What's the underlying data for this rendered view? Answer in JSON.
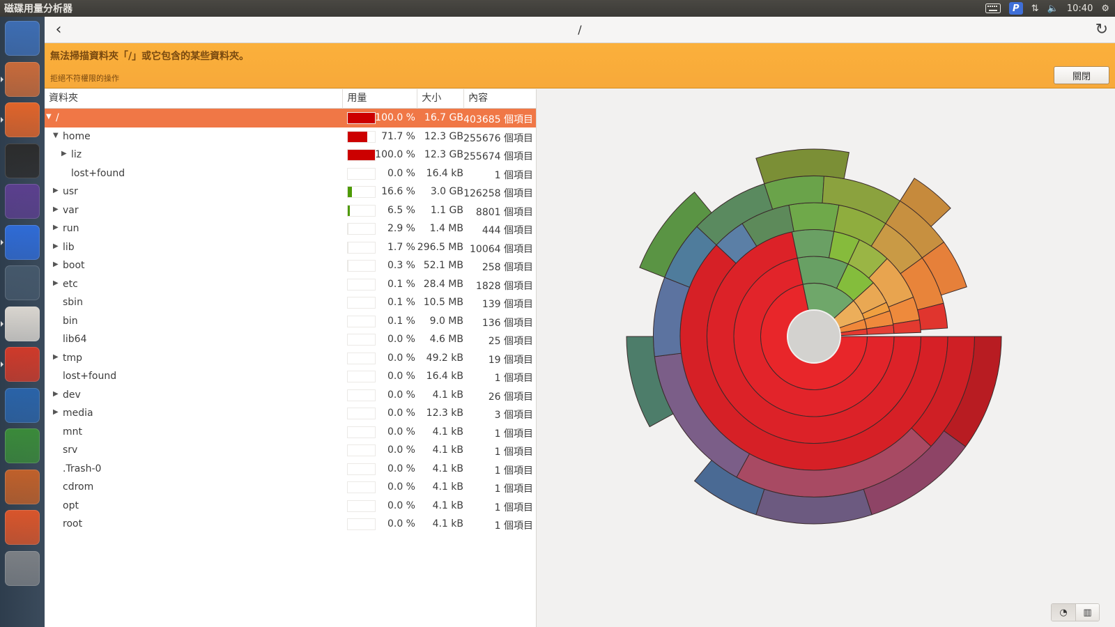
{
  "window": {
    "title": "磁碟用量分析器"
  },
  "tray": {
    "time": "10:40",
    "keyboard_icon": "keyboard-icon",
    "p_icon": "p-indicator-icon"
  },
  "header": {
    "path": "/"
  },
  "infobar": {
    "primary": "無法掃描資料夾「/」或它包含的某些資料夾。",
    "secondary": "拒絕不符權限的操作",
    "close_label": "關閉"
  },
  "tree": {
    "columns": {
      "folder": "資料夾",
      "usage": "用量",
      "size": "大小",
      "contents": "內容"
    },
    "rows": [
      {
        "name": "/",
        "level": 0,
        "expander": "open",
        "pct": "100.0 %",
        "size": "16.7 GB",
        "items": "403685 個項目",
        "usage": 1.0,
        "bar_color": "#cc0000",
        "selected": true
      },
      {
        "name": "home",
        "level": 1,
        "expander": "open",
        "pct": "71.7 %",
        "size": "12.3 GB",
        "items": "255676 個項目",
        "usage": 0.717,
        "bar_color": "#cc0000"
      },
      {
        "name": "liz",
        "level": 2,
        "expander": "closed",
        "pct": "100.0 %",
        "size": "12.3 GB",
        "items": "255674 個項目",
        "usage": 1.0,
        "bar_color": "#cc0000"
      },
      {
        "name": "lost+found",
        "level": 2,
        "expander": "none",
        "pct": "0.0 %",
        "size": "16.4 kB",
        "items": "1 個項目",
        "usage": 0.0,
        "bar_color": "#cc0000"
      },
      {
        "name": "usr",
        "level": 1,
        "expander": "closed",
        "pct": "16.6 %",
        "size": "3.0 GB",
        "items": "126258 個項目",
        "usage": 0.166,
        "bar_color": "#4e9a06"
      },
      {
        "name": "var",
        "level": 1,
        "expander": "closed",
        "pct": "6.5 %",
        "size": "1.1 GB",
        "items": "8801 個項目",
        "usage": 0.065,
        "bar_color": "#4e9a06"
      },
      {
        "name": "run",
        "level": 1,
        "expander": "closed",
        "pct": "2.9 %",
        "size": "1.4 MB",
        "items": "444 個項目",
        "usage": 0.029,
        "bar_color": "#e8e6e3"
      },
      {
        "name": "lib",
        "level": 1,
        "expander": "closed",
        "pct": "1.7 %",
        "size": "296.5 MB",
        "items": "10064 個項目",
        "usage": 0.017,
        "bar_color": "#e8e6e3"
      },
      {
        "name": "boot",
        "level": 1,
        "expander": "closed",
        "pct": "0.3 %",
        "size": "52.1 MB",
        "items": "258 個項目",
        "usage": 0.003,
        "bar_color": "#e8e6e3"
      },
      {
        "name": "etc",
        "level": 1,
        "expander": "closed",
        "pct": "0.1 %",
        "size": "28.4 MB",
        "items": "1828 個項目",
        "usage": 0.001,
        "bar_color": "#e8e6e3"
      },
      {
        "name": "sbin",
        "level": 1,
        "expander": "none",
        "pct": "0.1 %",
        "size": "10.5 MB",
        "items": "139 個項目",
        "usage": 0.001,
        "bar_color": "#e8e6e3"
      },
      {
        "name": "bin",
        "level": 1,
        "expander": "none",
        "pct": "0.1 %",
        "size": "9.0 MB",
        "items": "136 個項目",
        "usage": 0.001,
        "bar_color": "#e8e6e3"
      },
      {
        "name": "lib64",
        "level": 1,
        "expander": "none",
        "pct": "0.0 %",
        "size": "4.6 MB",
        "items": "25 個項目",
        "usage": 0.0,
        "bar_color": "#e8e6e3"
      },
      {
        "name": "tmp",
        "level": 1,
        "expander": "closed",
        "pct": "0.0 %",
        "size": "49.2 kB",
        "items": "19 個項目",
        "usage": 0.0,
        "bar_color": "#e8e6e3"
      },
      {
        "name": "lost+found",
        "level": 1,
        "expander": "none",
        "pct": "0.0 %",
        "size": "16.4 kB",
        "items": "1 個項目",
        "usage": 0.0,
        "bar_color": "#e8e6e3"
      },
      {
        "name": "dev",
        "level": 1,
        "expander": "closed",
        "pct": "0.0 %",
        "size": "4.1 kB",
        "items": "26 個項目",
        "usage": 0.0,
        "bar_color": "#e8e6e3"
      },
      {
        "name": "media",
        "level": 1,
        "expander": "closed",
        "pct": "0.0 %",
        "size": "12.3 kB",
        "items": "3 個項目",
        "usage": 0.0,
        "bar_color": "#e8e6e3"
      },
      {
        "name": "mnt",
        "level": 1,
        "expander": "none",
        "pct": "0.0 %",
        "size": "4.1 kB",
        "items": "1 個項目",
        "usage": 0.0,
        "bar_color": "#e8e6e3"
      },
      {
        "name": "srv",
        "level": 1,
        "expander": "none",
        "pct": "0.0 %",
        "size": "4.1 kB",
        "items": "1 個項目",
        "usage": 0.0,
        "bar_color": "#e8e6e3"
      },
      {
        "name": ".Trash-0",
        "level": 1,
        "expander": "none",
        "pct": "0.0 %",
        "size": "4.1 kB",
        "items": "1 個項目",
        "usage": 0.0,
        "bar_color": "#e8e6e3"
      },
      {
        "name": "cdrom",
        "level": 1,
        "expander": "none",
        "pct": "0.0 %",
        "size": "4.1 kB",
        "items": "1 個項目",
        "usage": 0.0,
        "bar_color": "#e8e6e3"
      },
      {
        "name": "opt",
        "level": 1,
        "expander": "none",
        "pct": "0.0 %",
        "size": "4.1 kB",
        "items": "1 個項目",
        "usage": 0.0,
        "bar_color": "#e8e6e3"
      },
      {
        "name": "root",
        "level": 1,
        "expander": "none",
        "pct": "0.0 %",
        "size": "4.1 kB",
        "items": "1 個項目",
        "usage": 0.0,
        "bar_color": "#e8e6e3"
      }
    ]
  },
  "launcher": [
    {
      "name": "dash-home-icon",
      "color": "#3d6db3"
    },
    {
      "name": "files-icon",
      "color": "#c86a3a",
      "running": true
    },
    {
      "name": "firefox-icon",
      "color": "#e0642a",
      "running": true
    },
    {
      "name": "terminal-icon",
      "color": "#2c2c2c"
    },
    {
      "name": "eclipse-icon",
      "color": "#5b3f8e"
    },
    {
      "name": "p-app-icon",
      "color": "#2f6bd6",
      "running": true
    },
    {
      "name": "workspace-switcher-icon",
      "color": "#45586b"
    },
    {
      "name": "text-editor-icon",
      "color": "#d9d5cf",
      "running": true
    },
    {
      "name": "disk-usage-analyzer-icon",
      "color": "#cf3a2a",
      "running": true
    },
    {
      "name": "writer-icon",
      "color": "#2a63a8"
    },
    {
      "name": "calc-icon",
      "color": "#3a8a3a"
    },
    {
      "name": "impress-icon",
      "color": "#c0602a"
    },
    {
      "name": "amazon-icon",
      "color": "#d9552b"
    },
    {
      "name": "trash-icon",
      "color": "#7b7f84"
    }
  ],
  "sunburst": {
    "rings": [
      {
        "level": 1,
        "segments": [
          {
            "start": 0.0,
            "end": 0.717,
            "color": "#e8262a"
          },
          {
            "start": 0.717,
            "end": 0.883,
            "color": "#6fa76a"
          },
          {
            "start": 0.883,
            "end": 0.948,
            "color": "#ecae5a"
          },
          {
            "start": 0.948,
            "end": 0.977,
            "color": "#f0883a"
          },
          {
            "start": 0.977,
            "end": 0.994,
            "color": "#e43a30"
          }
        ]
      },
      {
        "level": 2,
        "segments": [
          {
            "start": 0.0,
            "end": 0.717,
            "color": "#e2242a"
          },
          {
            "start": 0.717,
            "end": 0.82,
            "color": "#68a064"
          },
          {
            "start": 0.82,
            "end": 0.883,
            "color": "#84bd3c"
          },
          {
            "start": 0.883,
            "end": 0.93,
            "color": "#e9a853"
          },
          {
            "start": 0.93,
            "end": 0.948,
            "color": "#f0a040"
          },
          {
            "start": 0.948,
            "end": 0.977,
            "color": "#ef8a3c"
          },
          {
            "start": 0.977,
            "end": 0.994,
            "color": "#e44036"
          }
        ]
      },
      {
        "level": 3,
        "segments": [
          {
            "start": 0.0,
            "end": 0.717,
            "color": "#dc2228"
          },
          {
            "start": 0.717,
            "end": 0.78,
            "color": "#6aa064"
          },
          {
            "start": 0.78,
            "end": 0.82,
            "color": "#86bb3c"
          },
          {
            "start": 0.82,
            "end": 0.87,
            "color": "#9ab545"
          },
          {
            "start": 0.87,
            "end": 0.94,
            "color": "#e8a44f"
          },
          {
            "start": 0.94,
            "end": 0.975,
            "color": "#ee8a3c"
          },
          {
            "start": 0.975,
            "end": 0.994,
            "color": "#e23a30"
          }
        ]
      },
      {
        "level": 4,
        "segments": [
          {
            "start": 0.0,
            "end": 0.62,
            "color": "#d62026"
          },
          {
            "start": 0.62,
            "end": 0.66,
            "color": "#5b7fa6"
          },
          {
            "start": 0.66,
            "end": 0.72,
            "color": "#5d8a5a"
          },
          {
            "start": 0.72,
            "end": 0.78,
            "color": "#6fa94a"
          },
          {
            "start": 0.78,
            "end": 0.84,
            "color": "#8fad3e"
          },
          {
            "start": 0.84,
            "end": 0.9,
            "color": "#c99a45"
          },
          {
            "start": 0.9,
            "end": 0.96,
            "color": "#e8843a"
          },
          {
            "start": 0.96,
            "end": 0.99,
            "color": "#e0352e"
          }
        ]
      },
      {
        "level": 5,
        "segments": [
          {
            "start": 0.0,
            "end": 0.12,
            "color": "#cf1f25"
          },
          {
            "start": 0.12,
            "end": 0.33,
            "color": "#a84a63"
          },
          {
            "start": 0.33,
            "end": 0.48,
            "color": "#7b5e88"
          },
          {
            "start": 0.48,
            "end": 0.56,
            "color": "#5c73a0"
          },
          {
            "start": 0.56,
            "end": 0.62,
            "color": "#4f7c9c"
          },
          {
            "start": 0.62,
            "end": 0.7,
            "color": "#5a8a5f"
          },
          {
            "start": 0.7,
            "end": 0.76,
            "color": "#6aa34a"
          },
          {
            "start": 0.76,
            "end": 0.84,
            "color": "#8ba23e"
          },
          {
            "start": 0.84,
            "end": 0.9,
            "color": "#c79040"
          },
          {
            "start": 0.9,
            "end": 0.95,
            "color": "#e6803a"
          }
        ]
      },
      {
        "level": 6,
        "segments": [
          {
            "start": 0.0,
            "end": 0.1,
            "color": "#b81c22"
          },
          {
            "start": 0.1,
            "end": 0.2,
            "color": "#8e4466"
          },
          {
            "start": 0.2,
            "end": 0.3,
            "color": "#6c5a80"
          },
          {
            "start": 0.3,
            "end": 0.36,
            "color": "#4a6a94"
          },
          {
            "start": 0.42,
            "end": 0.5,
            "color": "#4d7d6a"
          },
          {
            "start": 0.56,
            "end": 0.64,
            "color": "#5a9444"
          },
          {
            "start": 0.7,
            "end": 0.78,
            "color": "#7b8f36"
          },
          {
            "start": 0.84,
            "end": 0.88,
            "color": "#c68a3c"
          }
        ]
      }
    ]
  }
}
